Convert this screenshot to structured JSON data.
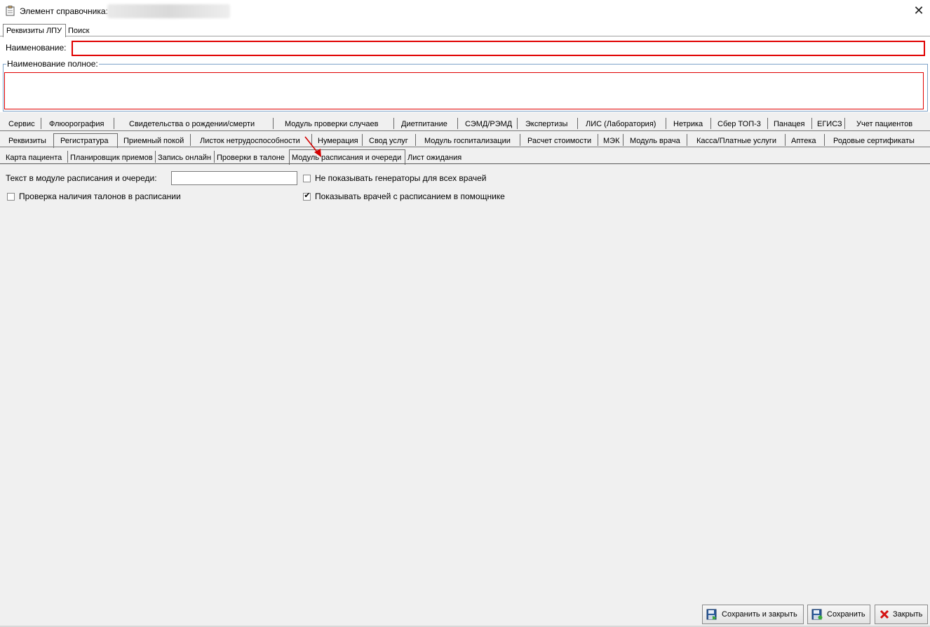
{
  "window": {
    "title": "Элемент справочника:",
    "close_glyph": "✕"
  },
  "top_tabs": [
    {
      "label": "Реквизиты ЛПУ",
      "active": true
    },
    {
      "label": "Поиск",
      "active": false
    }
  ],
  "form": {
    "name_label": "Наименование:",
    "name_value": "",
    "full_name_label": "Наименование полное:",
    "full_name_value": ""
  },
  "tabs_row1": [
    "Сервис",
    "Флюорография",
    "Свидетельства о рождении/смерти",
    "Модуль проверки случаев",
    "Диетпитание",
    "СЭМД/РЭМД",
    "Экспертизы",
    "ЛИС (Лаборатория)",
    "Нетрика",
    "Сбер ТОП-3",
    "Панацея",
    "ЕГИСЗ",
    "Учет пациентов"
  ],
  "tabs_row2": [
    "Реквизиты",
    "Регистратура",
    "Приемный покой",
    "Листок нетрудоспособности",
    "Нумерация",
    "Свод услуг",
    "Модуль госпитализации",
    "Расчет стоимости",
    "МЭК",
    "Модуль врача",
    "Касса/Платные услуги",
    "Аптека",
    "Родовые сертификаты"
  ],
  "tabs_row2_active": "Регистратура",
  "tabs_row3": [
    "Карта пациента",
    "Планировщик приемов",
    "Запись онлайн",
    "Проверки в талоне",
    "Модуль расписания и очереди",
    "Лист ожидания"
  ],
  "tabs_row3_active": "Модуль расписания и очереди",
  "content": {
    "text_module_label": "Текст в модуле расписания и очереди:",
    "text_module_value": "",
    "cb_no_generators": {
      "label": "Не показывать генераторы для всех врачей",
      "checked": false
    },
    "cb_ticket_check": {
      "label": "Проверка наличия талонов в расписании",
      "checked": false
    },
    "cb_show_doctors": {
      "label": "Показывать врачей с расписанием в помощнике",
      "checked": true
    }
  },
  "buttons": {
    "save_close": "Сохранить и закрыть",
    "save": "Сохранить",
    "close": "Закрыть"
  },
  "colors": {
    "required_border": "#e00000",
    "arrow": "#d40000",
    "group_border": "#7ea3c8"
  },
  "icons": {
    "title": "clipboard-icon",
    "save_close": "floppy-disk-arrow-icon",
    "save": "floppy-disk-icon",
    "close": "red-x-icon"
  }
}
